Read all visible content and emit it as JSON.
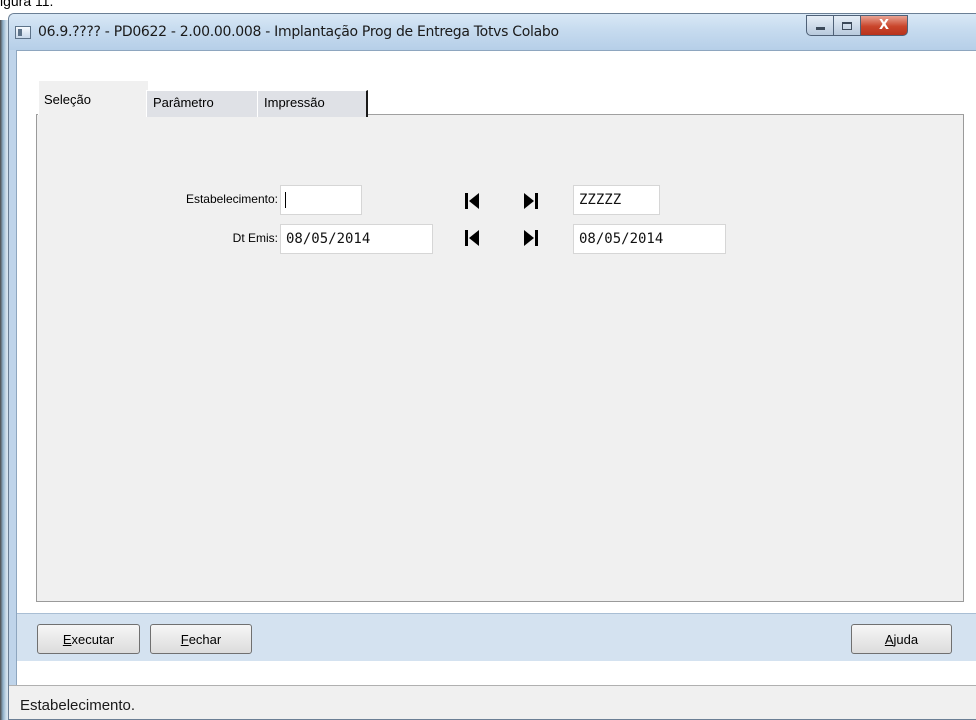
{
  "caption_fragment": "igura 11.",
  "window": {
    "title": "06.9.???? - PD0622 - 2.00.00.008 - Implantação Prog de Entrega Totvs Colabo",
    "close_glyph": "X"
  },
  "tabs": [
    {
      "label": "Seleção",
      "active": true
    },
    {
      "label": "Parâmetro",
      "active": false
    },
    {
      "label": "Impressão",
      "active": false
    }
  ],
  "form": {
    "estabelecimento": {
      "label": "Estabelecimento:",
      "from_value": "",
      "to_value": "ZZZZZ"
    },
    "dt_emis": {
      "label": "Dt Emis:",
      "from_value": "08/05/2014",
      "to_value": "08/05/2014"
    }
  },
  "icons": {
    "first": "first-record-icon",
    "last": "last-record-icon"
  },
  "buttons": {
    "executar": {
      "accel": "E",
      "rest": "xecutar"
    },
    "fechar": {
      "accel": "F",
      "rest": "echar"
    },
    "ajuda": {
      "accel": "A",
      "rest": "juda"
    }
  },
  "status_text": "Estabelecimento."
}
